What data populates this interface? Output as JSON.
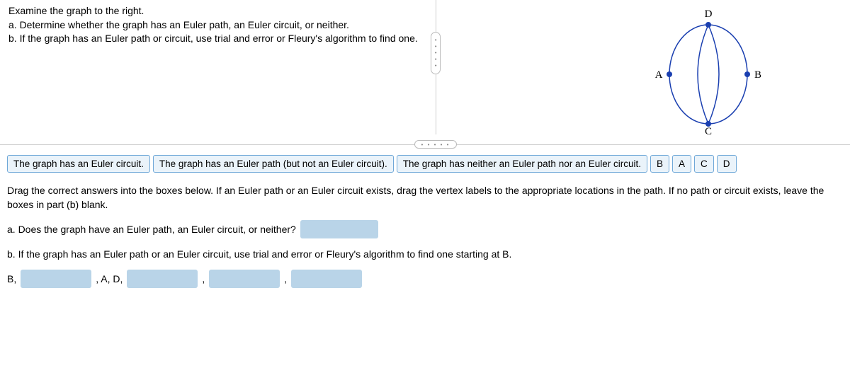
{
  "prompt": {
    "intro": "Examine the graph to the right.",
    "part_a": "a. Determine whether the graph has an Euler path, an Euler circuit, or neither.",
    "part_b": "b. If the graph has an Euler path or circuit, use trial and error or Fleury's algorithm to find one."
  },
  "graph": {
    "labels": {
      "top": "D",
      "left": "A",
      "right": "B",
      "bottom": "C"
    }
  },
  "drag_items": {
    "opt_circuit": "The graph has an Euler circuit.",
    "opt_path": "The graph has an Euler path (but not an Euler circuit).",
    "opt_neither": "The graph has neither an Euler path nor an Euler circuit.",
    "v_b": "B",
    "v_a": "A",
    "v_c": "C",
    "v_d": "D"
  },
  "instructions": "Drag the correct answers into the boxes below. If an Euler path or an Euler circuit exists, drag the vertex labels to the appropriate locations in the path. If no path or circuit exists, leave the boxes in part (b) blank.",
  "question_a": "a. Does the graph have an Euler path, an Euler circuit, or neither?",
  "question_b": "b. If the graph has an Euler path or an Euler circuit, use trial and error or Fleury's algorithm to find one starting at B.",
  "answer_b": {
    "prefix": "B,",
    "mid": ", A, D,",
    "sep": ","
  },
  "handle_dots": "• • • • •"
}
